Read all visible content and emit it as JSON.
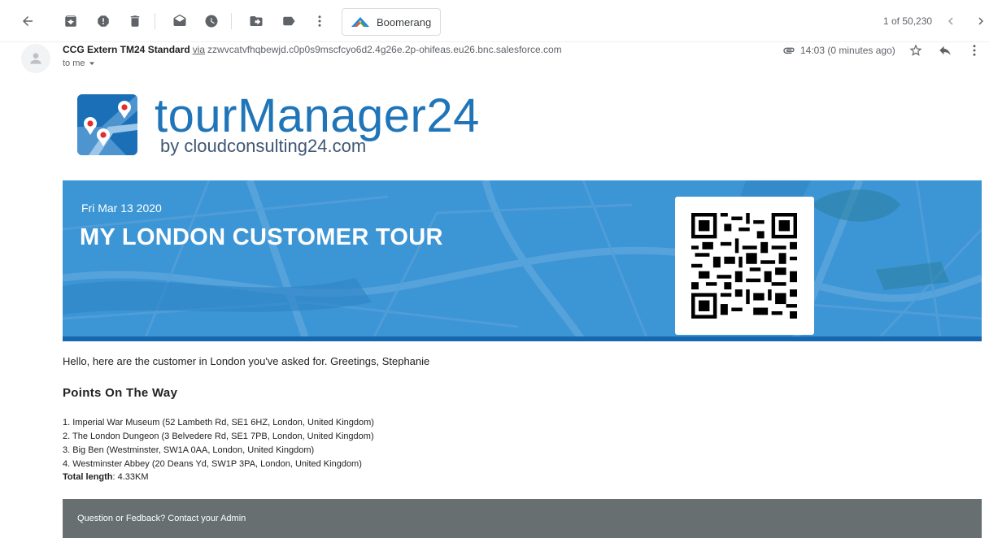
{
  "toolbar": {
    "boomerang_label": "Boomerang",
    "pager": "1 of 50,230"
  },
  "email": {
    "sender_name": "CCG Extern TM24 Standard",
    "via_label": "via",
    "sender_address": "zzwvcatvfhqbewjd.c0p0s9mscfcyo6d2.4g26e.2p-ohifeas.eu26.bnc.salesforce.com",
    "recipient": "to me",
    "timestamp": "14:03 (0 minutes ago)"
  },
  "logo": {
    "title": "tourManager24",
    "subtitle": "by cloudconsulting24.com",
    "color": "#1f75b8"
  },
  "banner": {
    "date": "Fri Mar 13 2020",
    "title": "MY LONDON CUSTOMER TOUR",
    "bg_color": "#3c95d4",
    "bar_color": "#1767ae"
  },
  "body": {
    "greeting": "Hello, here are the customer in London you've asked for. Greetings, Stephanie",
    "section_title": "Points On The Way",
    "points": [
      "1. Imperial War Museum (52 Lambeth Rd, SE1 6HZ, London, United Kingdom)",
      "2. The London Dungeon (3 Belvedere Rd, SE1 7PB, London, United Kingdom)",
      "3. Big Ben (Westminster, SW1A 0AA, London, United Kingdom)",
      "4. Westminster Abbey (20 Deans Yd, SW1P 3PA, London, United Kingdom)"
    ],
    "total_label": "Total length",
    "total_value": ": 4.33KM"
  },
  "footer": {
    "text": "Question or Fedback? Contact your Admin",
    "bg_color": "#676f70"
  }
}
